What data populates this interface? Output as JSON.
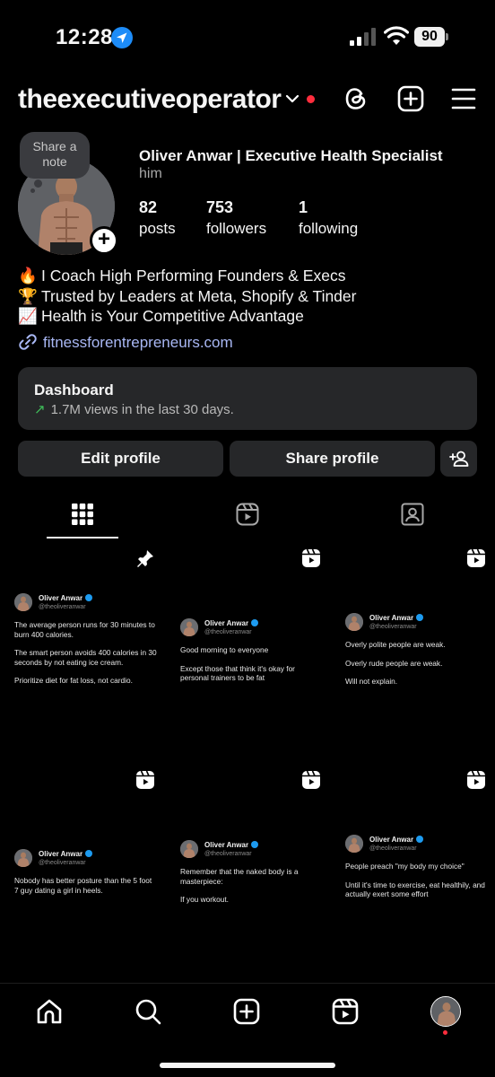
{
  "status_bar": {
    "time": "12:28",
    "battery": "90"
  },
  "header": {
    "username": "theexecutiveoperator"
  },
  "profile": {
    "note_label": "Share a note",
    "full_name": "Oliver Anwar | Executive Health Specialist",
    "pronouns": "him",
    "stats": [
      {
        "num": "82",
        "label": "posts"
      },
      {
        "num": "753",
        "label": "followers"
      },
      {
        "num": "1",
        "label": "following"
      }
    ],
    "bio": [
      {
        "emoji": "🔥",
        "text": "I Coach High Performing Founders & Execs"
      },
      {
        "emoji": "🏆",
        "text": "Trusted by Leaders at Meta, Shopify & Tinder"
      },
      {
        "emoji": "📈",
        "text": "Health is Your Competitive Advantage"
      }
    ],
    "link": "fitnessforentrepreneurs.com"
  },
  "dashboard": {
    "title": "Dashboard",
    "subtitle": "1.7M views in the last 30 days.",
    "trend_icon": "arrow-up-right-icon",
    "trend_color": "#3fbf5a"
  },
  "buttons": {
    "edit": "Edit profile",
    "share": "Share profile"
  },
  "tabs": [
    "grid-icon",
    "reels-icon",
    "tagged-icon"
  ],
  "posts": [
    {
      "badge": "pin-icon",
      "name": "Oliver Anwar",
      "handle": "@theoliveranwar",
      "paragraphs": [
        "The average person runs for 30 minutes to burn 400 calories.",
        "The smart person avoids 400 calories in 30 seconds by not eating ice cream.",
        "Prioritize diet for fat loss, not cardio."
      ]
    },
    {
      "badge": "reel-icon",
      "name": "Oliver Anwar",
      "handle": "@theoliveranwar",
      "paragraphs": [
        "Good morning to everyone",
        "Except those that think it's okay for personal trainers to be fat"
      ]
    },
    {
      "badge": "reel-icon",
      "name": "Oliver Anwar",
      "handle": "@theoliveranwar",
      "paragraphs": [
        "Overly polite people are weak.",
        "Overly rude people are weak.",
        "Will not explain."
      ]
    },
    {
      "badge": "reel-icon",
      "name": "Oliver Anwar",
      "handle": "@theoliveranwar",
      "paragraphs": [
        "Nobody has better posture than the 5 foot 7 guy dating a girl in heels."
      ]
    },
    {
      "badge": "reel-icon",
      "name": "Oliver Anwar",
      "handle": "@theoliveranwar",
      "paragraphs": [
        "Remember that the naked body is a masterpiece:",
        "If you workout."
      ]
    },
    {
      "badge": "reel-icon",
      "name": "Oliver Anwar",
      "handle": "@theoliveranwar",
      "paragraphs": [
        "People preach \"my body my choice\"",
        "Until it's time to exercise, eat healthily, and actually exert some effort"
      ]
    }
  ],
  "bottom_nav": [
    "home-icon",
    "search-icon",
    "create-icon",
    "reels-icon",
    "profile-avatar"
  ],
  "colors": {
    "link": "#a9b8f5",
    "notification_dot": "#ff2d3d",
    "card_bg": "#262729",
    "verified": "#1d9bf0"
  }
}
